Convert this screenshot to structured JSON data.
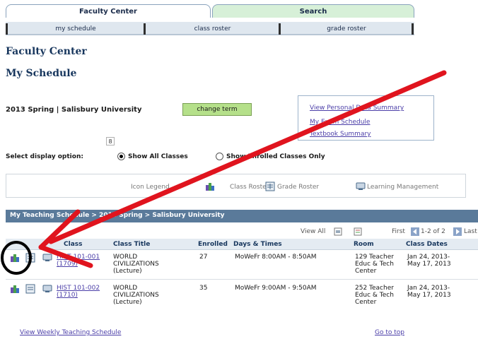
{
  "tabs": {
    "faculty_center": "Faculty Center",
    "search": "Search"
  },
  "subtabs": {
    "my_schedule": "my schedule",
    "class_roster": "class roster",
    "grade_roster": "grade roster"
  },
  "page": {
    "heading": "Faculty Center",
    "subheading": "My Schedule",
    "term": "2013 Spring | Salisbury University",
    "change_term": "change term",
    "mini_value": "8"
  },
  "links": {
    "personal_data": "View Personal Data Summary",
    "exam_schedule": "My Exam Schedule",
    "textbook": "Textbook Summary"
  },
  "display_option": {
    "label": "Select display option:",
    "all": "Show All Classes",
    "enrolled": "Show Enrolled Classes Only",
    "selected": "all"
  },
  "legend": {
    "title": "Icon Legend",
    "class_roster": "Class Roster",
    "grade_roster": "Grade Roster",
    "learning_mgmt": "Learning Management"
  },
  "grid": {
    "title": "My Teaching Schedule > 2013 Spring > Salisbury University",
    "view_all": "View All",
    "first": "First",
    "range": "1-2 of 2",
    "last": "Last",
    "columns": [
      "Class",
      "Class Title",
      "Enrolled",
      "Days & Times",
      "Room",
      "Class Dates"
    ],
    "rows": [
      {
        "class_code": "HIST 101-001",
        "class_id": "(1709)",
        "title_1": "WORLD",
        "title_2": "CIVILIZATIONS",
        "title_3": "(Lecture)",
        "enrolled": "27",
        "days_times": "MoWeFr 8:00AM - 8:50AM",
        "room_1": "129 Teacher",
        "room_2": "Educ & Tech",
        "room_3": "Center",
        "dates_1": "Jan 24, 2013-",
        "dates_2": "May 17, 2013"
      },
      {
        "class_code": "HIST 101-002",
        "class_id": "(1710)",
        "title_1": "WORLD",
        "title_2": "CIVILIZATIONS",
        "title_3": "(Lecture)",
        "enrolled": "35",
        "days_times": "MoWeFr 9:00AM - 9:50AM",
        "room_1": "252 Teacher",
        "room_2": "Educ & Tech",
        "room_3": "Center",
        "dates_1": "Jan 24, 2013-",
        "dates_2": "May 17, 2013"
      }
    ]
  },
  "footer": {
    "weekly": "View Weekly Teaching Schedule",
    "top": "Go to top"
  },
  "colors": {
    "arrow": "#e0141e",
    "header_bar": "#5a7a9a",
    "link": "#4b3ea8",
    "button_green": "#b5e08a"
  }
}
